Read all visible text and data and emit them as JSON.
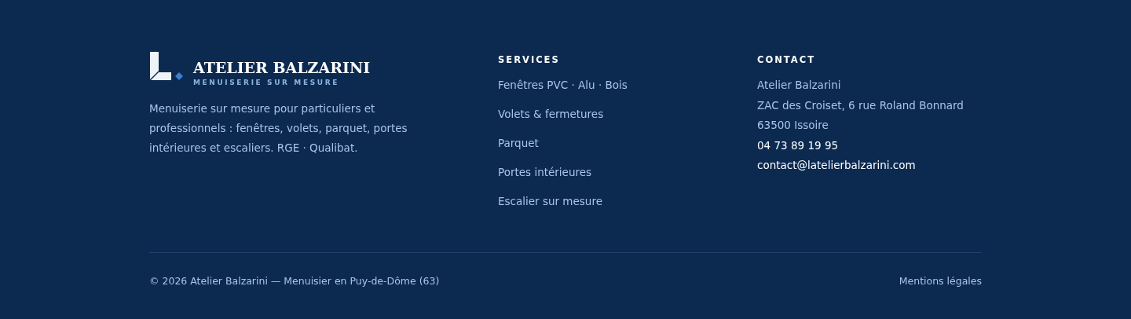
{
  "brand": {
    "name": "ATELIER BALZARINI",
    "tagline": "MENUISERIE SUR MESURE",
    "description": "Menuiserie sur mesure pour particuliers et professionnels : fenêtres, volets, parquet, portes intérieures et escaliers. RGE · Qualibat."
  },
  "services": {
    "heading": "SERVICES",
    "links": [
      "Fenêtres PVC · Alu · Bois",
      "Volets & fermetures",
      "Parquet",
      "Portes intérieures",
      "Escalier sur mesure"
    ]
  },
  "contact": {
    "heading": "CONTACT",
    "lines": [
      {
        "kind": "text",
        "text": "Atelier Balzarini"
      },
      {
        "kind": "text",
        "text": "ZAC des Croiset, 6 rue Roland Bonnard"
      },
      {
        "kind": "text",
        "text": "63500 Issoire"
      },
      {
        "kind": "link",
        "text": "04 73 89 19 95"
      },
      {
        "kind": "link",
        "text": "contact@latelierbalzarini.com"
      }
    ]
  },
  "bottom": {
    "copyright": "© 2026 Atelier Balzarini — Menuisier en Puy-de-Dôme (63)",
    "legal_link": "Mentions légales"
  }
}
